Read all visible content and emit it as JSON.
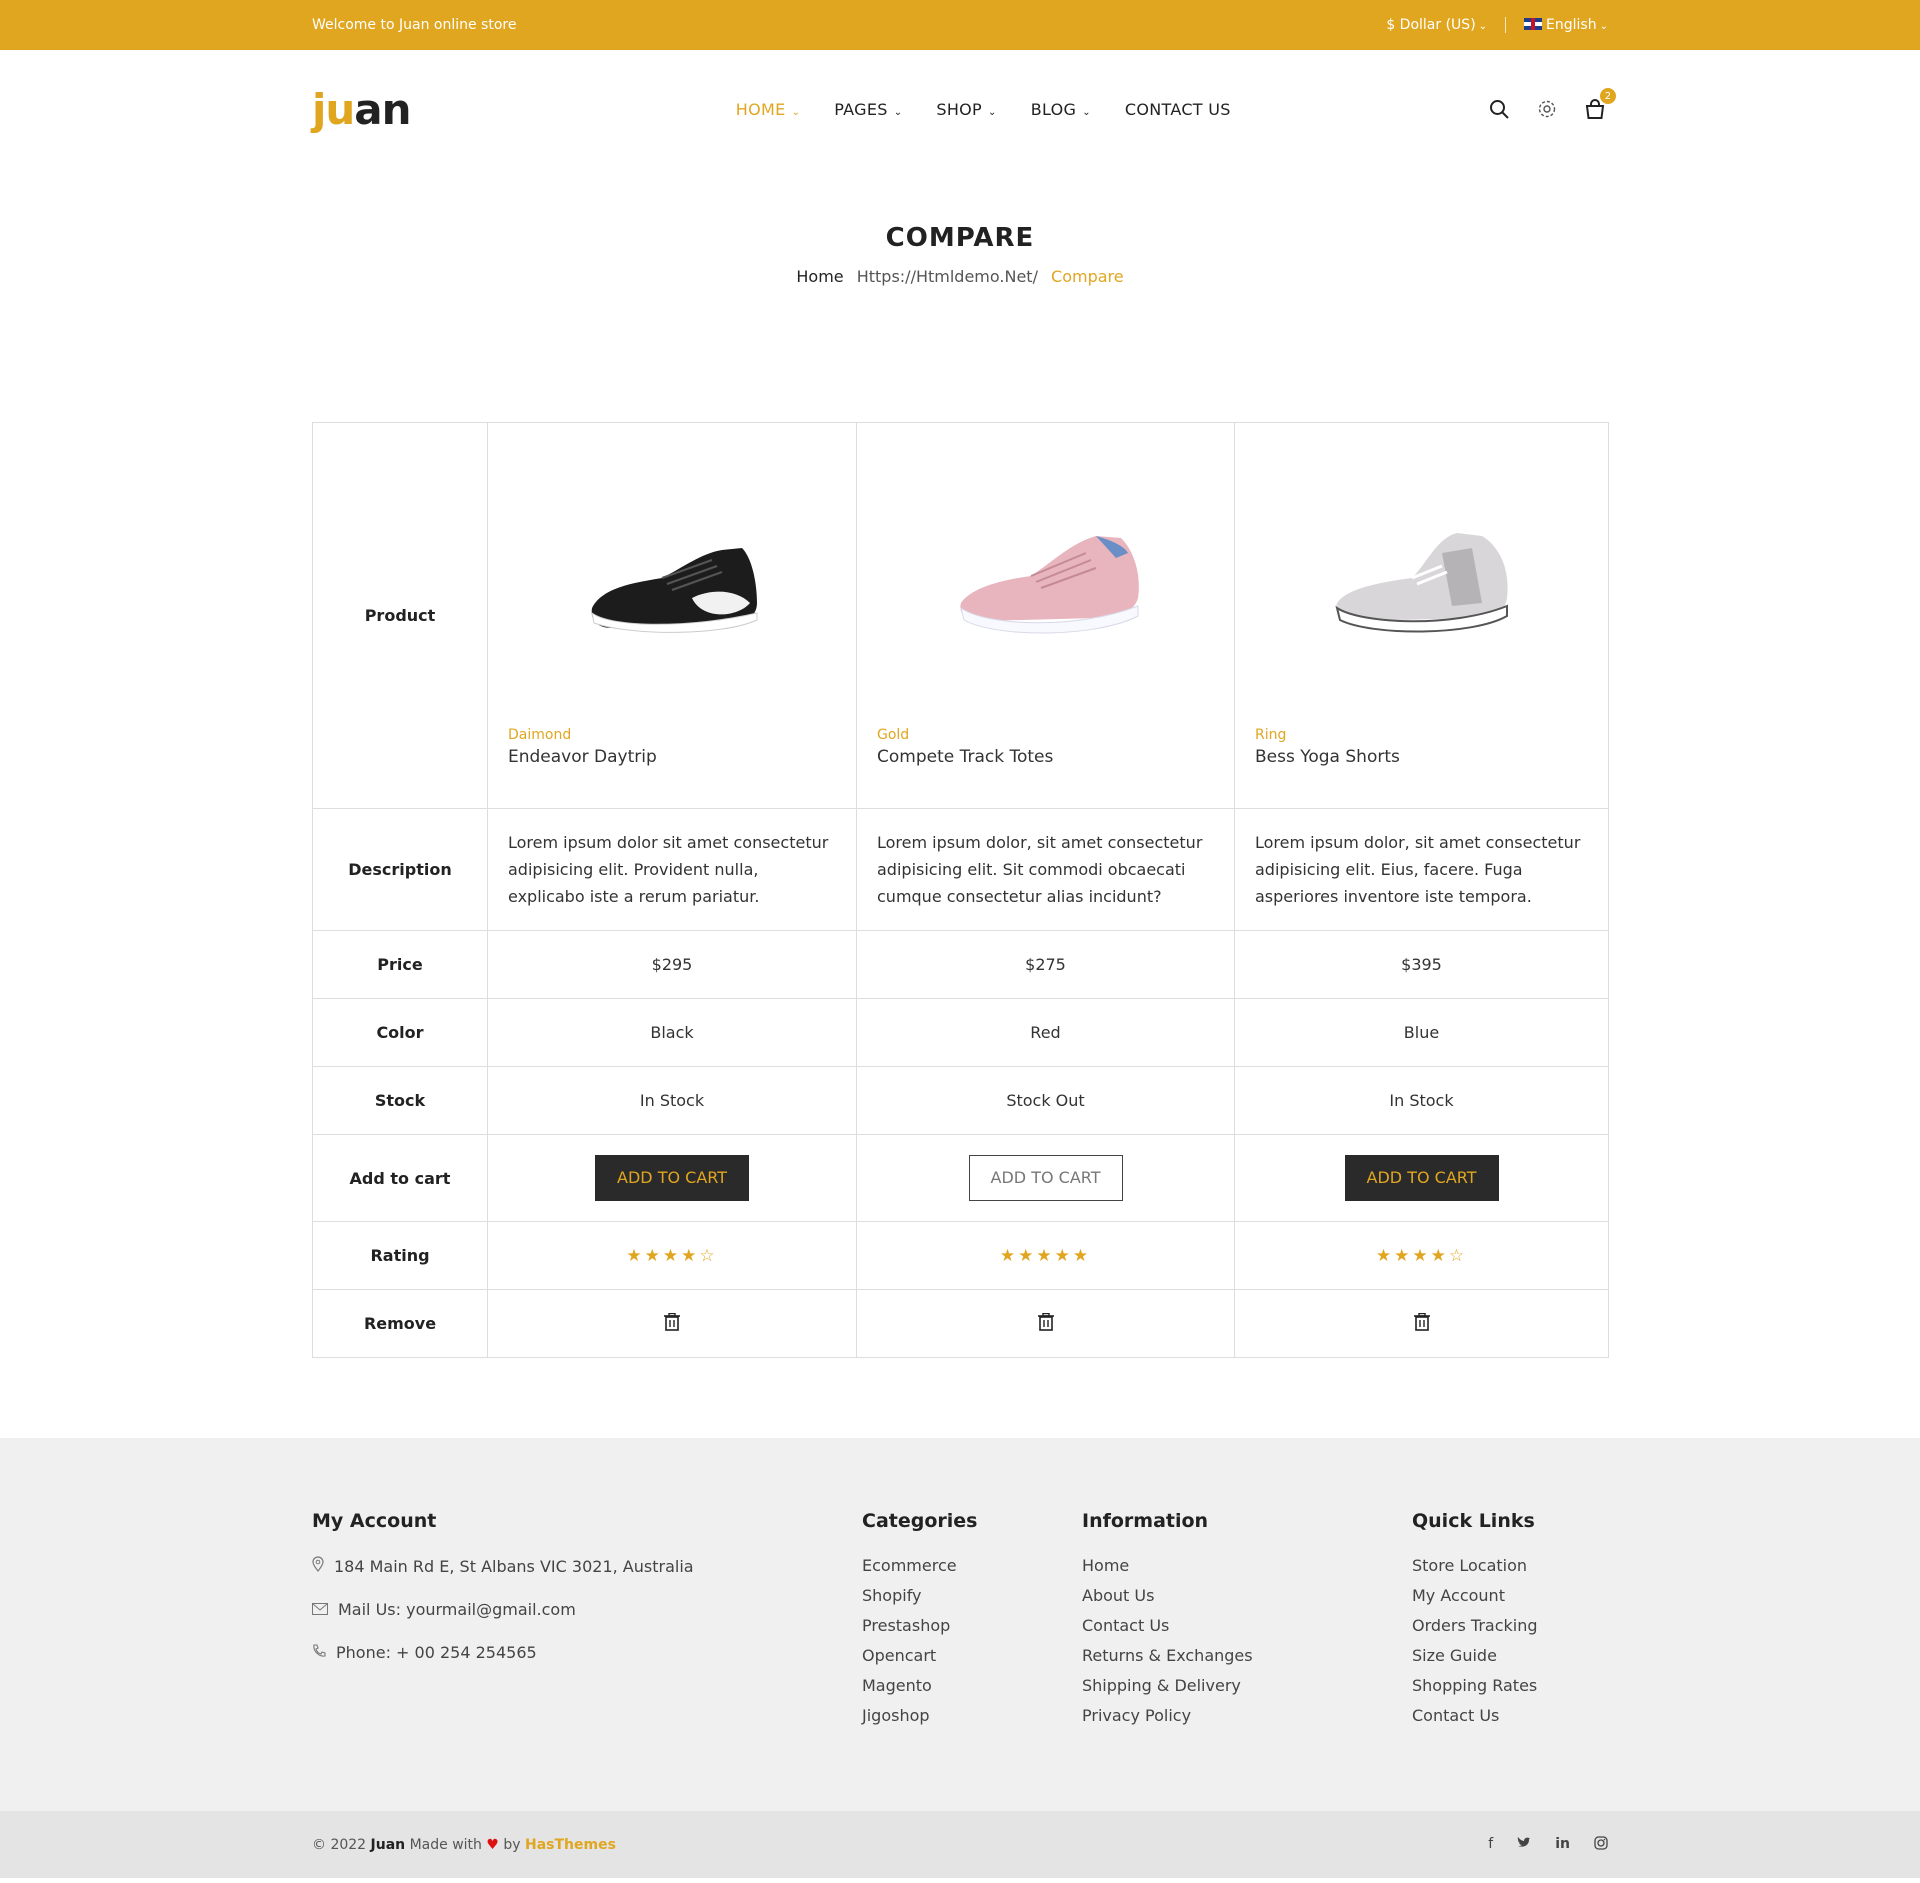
{
  "topbar": {
    "welcome": "Welcome to Juan online store",
    "currency": "$ Dollar (US)",
    "language": "English"
  },
  "logo": {
    "part1": "ju",
    "part2": "an"
  },
  "nav": [
    {
      "label": "HOME"
    },
    {
      "label": "PAGES"
    },
    {
      "label": "SHOP"
    },
    {
      "label": "BLOG"
    },
    {
      "label": "CONTACT US"
    }
  ],
  "cart": {
    "count": "2"
  },
  "page": {
    "title": "COMPARE",
    "breadcrumb_home": "Home",
    "breadcrumb_mid": "Https://Htmldemo.Net/",
    "breadcrumb_current": "Compare"
  },
  "compare": {
    "row_labels": {
      "product": "Product",
      "description": "Description",
      "price": "Price",
      "color": "Color",
      "stock": "Stock",
      "cart": "Add to cart",
      "rating": "Rating",
      "remove": "Remove"
    },
    "products": [
      {
        "category": "Daimond",
        "name": "Endeavor Daytrip",
        "description": "Lorem ipsum dolor sit amet consectetur adipisicing elit. Provident nulla, explicabo iste a rerum pariatur.",
        "price": "$295",
        "color": "Black",
        "stock": "In Stock",
        "cart_label": "ADD TO CART",
        "rating": 4
      },
      {
        "category": "Gold",
        "name": "Compete Track Totes",
        "description": "Lorem ipsum dolor, sit amet consectetur adipisicing elit. Sit commodi obcaecati cumque consectetur alias incidunt?",
        "price": "$275",
        "color": "Red",
        "stock": "Stock Out",
        "cart_label": "ADD TO CART",
        "rating": 5
      },
      {
        "category": "Ring",
        "name": "Bess Yoga Shorts",
        "description": "Lorem ipsum dolor, sit amet consectetur adipisicing elit. Eius, facere. Fuga asperiores inventore iste tempora.",
        "price": "$395",
        "color": "Blue",
        "stock": "In Stock",
        "cart_label": "ADD TO CART",
        "rating": 4
      }
    ]
  },
  "footer": {
    "account": {
      "title": "My Account",
      "address": "184 Main Rd E, St Albans VIC 3021, Australia",
      "mail": "Mail Us: yourmail@gmail.com",
      "phone": "Phone: + 00 254 254565"
    },
    "categories": {
      "title": "Categories",
      "items": [
        "Ecommerce",
        "Shopify",
        "Prestashop",
        "Opencart",
        "Magento",
        "Jigoshop"
      ]
    },
    "information": {
      "title": "Information",
      "items": [
        "Home",
        "About Us",
        "Contact Us",
        "Returns & Exchanges",
        "Shipping & Delivery",
        "Privacy Policy"
      ]
    },
    "quick": {
      "title": "Quick Links",
      "items": [
        "Store Location",
        "My Account",
        "Orders Tracking",
        "Size Guide",
        "Shopping Rates",
        "Contact Us"
      ]
    }
  },
  "bottom": {
    "copyright": "© 2022",
    "brand": "Juan",
    "made_with": "Made with",
    "by": "by",
    "company": "HasThemes"
  },
  "colors": {
    "accent": "#e1a620",
    "dark": "#2a2a2a"
  }
}
